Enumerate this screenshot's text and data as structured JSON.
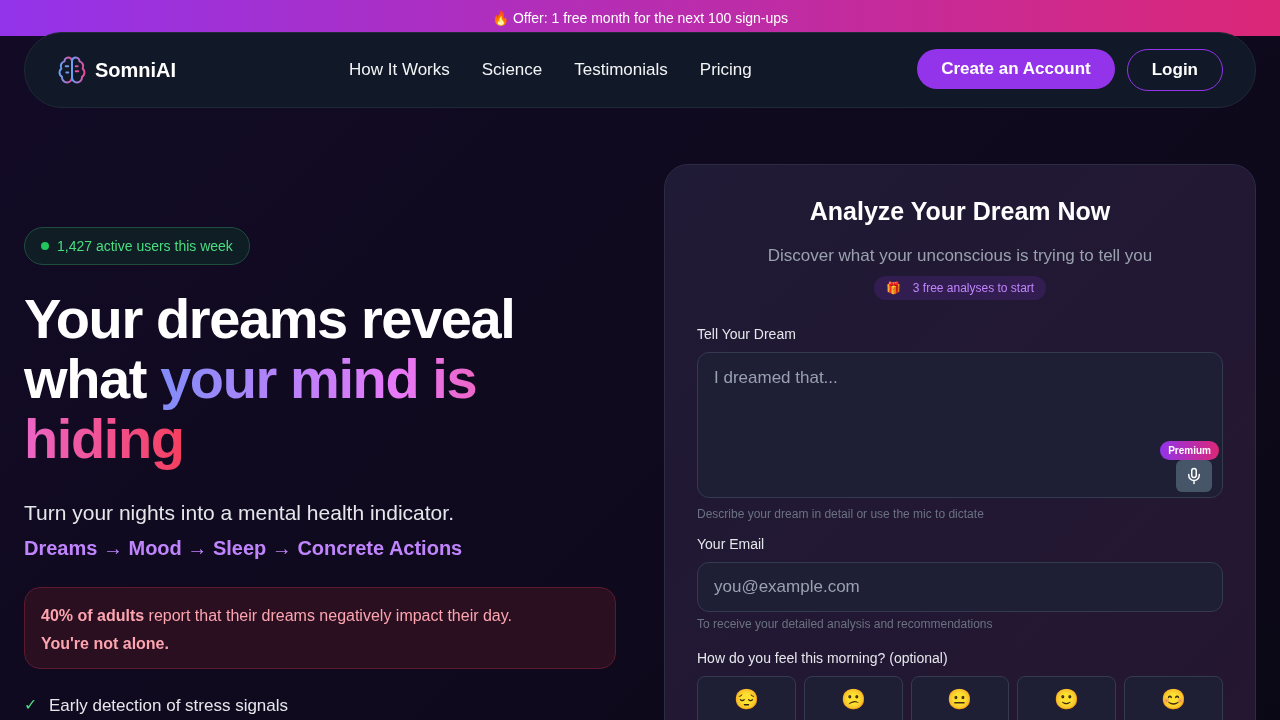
{
  "banner": {
    "icon": "🔥",
    "text": "Offer: 1 free month for the next 100 sign-ups"
  },
  "nav": {
    "brand": "SomniAI",
    "links": [
      "How It Works",
      "Science",
      "Testimonials",
      "Pricing"
    ],
    "primary_button": "Create an Account",
    "secondary_button": "Login"
  },
  "hero": {
    "badge": "1,427 active users this week",
    "headline_plain": "Your dreams reveal what ",
    "headline_highlight": "your mind is hiding",
    "subtitle": "Turn your nights into a mental health indicator.",
    "flow": "Dreams → Mood → Sleep → Concrete Actions",
    "stat_line": "**40% of adults** report that their dreams negatively impact their day.",
    "stat_emphasis": "You're not alone.",
    "features": [
      {
        "mark": "✓",
        "text": "Early detection of stress signals"
      }
    ]
  },
  "form": {
    "title": "Analyze Your Dream Now",
    "subtitle": "Discover what your unconscious is trying to tell you",
    "offer_icon": "🎁",
    "offer": "3 free analyses to start",
    "dream": {
      "label": "Tell Your Dream",
      "placeholder": "I dreamed that...",
      "hint": "Describe your dream in detail or use the mic to dictate",
      "mic_badge": "Premium"
    },
    "email": {
      "label": "Your Email",
      "placeholder": "you@example.com",
      "hint": "To receive your detailed analysis and recommendations"
    },
    "mood": {
      "label": "How do you feel this morning? (optional)",
      "options": [
        {
          "emoji": "😔",
          "selected": false
        },
        {
          "emoji": "😕",
          "selected": false
        },
        {
          "emoji": "😐",
          "selected": false
        },
        {
          "emoji": "🙂",
          "selected": false
        },
        {
          "emoji": "😊",
          "selected": false
        }
      ]
    }
  }
}
